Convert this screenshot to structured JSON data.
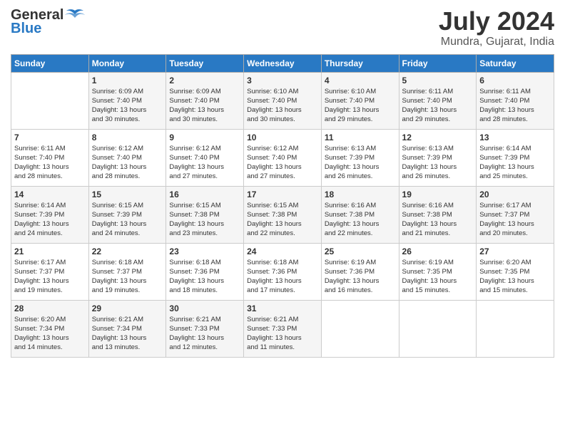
{
  "header": {
    "logo_line1": "General",
    "logo_line2": "Blue",
    "month": "July 2024",
    "location": "Mundra, Gujarat, India"
  },
  "days_of_week": [
    "Sunday",
    "Monday",
    "Tuesday",
    "Wednesday",
    "Thursday",
    "Friday",
    "Saturday"
  ],
  "weeks": [
    [
      {
        "day": "",
        "info": ""
      },
      {
        "day": "1",
        "info": "Sunrise: 6:09 AM\nSunset: 7:40 PM\nDaylight: 13 hours\nand 30 minutes."
      },
      {
        "day": "2",
        "info": "Sunrise: 6:09 AM\nSunset: 7:40 PM\nDaylight: 13 hours\nand 30 minutes."
      },
      {
        "day": "3",
        "info": "Sunrise: 6:10 AM\nSunset: 7:40 PM\nDaylight: 13 hours\nand 30 minutes."
      },
      {
        "day": "4",
        "info": "Sunrise: 6:10 AM\nSunset: 7:40 PM\nDaylight: 13 hours\nand 29 minutes."
      },
      {
        "day": "5",
        "info": "Sunrise: 6:11 AM\nSunset: 7:40 PM\nDaylight: 13 hours\nand 29 minutes."
      },
      {
        "day": "6",
        "info": "Sunrise: 6:11 AM\nSunset: 7:40 PM\nDaylight: 13 hours\nand 28 minutes."
      }
    ],
    [
      {
        "day": "7",
        "info": "Sunrise: 6:11 AM\nSunset: 7:40 PM\nDaylight: 13 hours\nand 28 minutes."
      },
      {
        "day": "8",
        "info": "Sunrise: 6:12 AM\nSunset: 7:40 PM\nDaylight: 13 hours\nand 28 minutes."
      },
      {
        "day": "9",
        "info": "Sunrise: 6:12 AM\nSunset: 7:40 PM\nDaylight: 13 hours\nand 27 minutes."
      },
      {
        "day": "10",
        "info": "Sunrise: 6:12 AM\nSunset: 7:40 PM\nDaylight: 13 hours\nand 27 minutes."
      },
      {
        "day": "11",
        "info": "Sunrise: 6:13 AM\nSunset: 7:39 PM\nDaylight: 13 hours\nand 26 minutes."
      },
      {
        "day": "12",
        "info": "Sunrise: 6:13 AM\nSunset: 7:39 PM\nDaylight: 13 hours\nand 26 minutes."
      },
      {
        "day": "13",
        "info": "Sunrise: 6:14 AM\nSunset: 7:39 PM\nDaylight: 13 hours\nand 25 minutes."
      }
    ],
    [
      {
        "day": "14",
        "info": "Sunrise: 6:14 AM\nSunset: 7:39 PM\nDaylight: 13 hours\nand 24 minutes."
      },
      {
        "day": "15",
        "info": "Sunrise: 6:15 AM\nSunset: 7:39 PM\nDaylight: 13 hours\nand 24 minutes."
      },
      {
        "day": "16",
        "info": "Sunrise: 6:15 AM\nSunset: 7:38 PM\nDaylight: 13 hours\nand 23 minutes."
      },
      {
        "day": "17",
        "info": "Sunrise: 6:15 AM\nSunset: 7:38 PM\nDaylight: 13 hours\nand 22 minutes."
      },
      {
        "day": "18",
        "info": "Sunrise: 6:16 AM\nSunset: 7:38 PM\nDaylight: 13 hours\nand 22 minutes."
      },
      {
        "day": "19",
        "info": "Sunrise: 6:16 AM\nSunset: 7:38 PM\nDaylight: 13 hours\nand 21 minutes."
      },
      {
        "day": "20",
        "info": "Sunrise: 6:17 AM\nSunset: 7:37 PM\nDaylight: 13 hours\nand 20 minutes."
      }
    ],
    [
      {
        "day": "21",
        "info": "Sunrise: 6:17 AM\nSunset: 7:37 PM\nDaylight: 13 hours\nand 19 minutes."
      },
      {
        "day": "22",
        "info": "Sunrise: 6:18 AM\nSunset: 7:37 PM\nDaylight: 13 hours\nand 19 minutes."
      },
      {
        "day": "23",
        "info": "Sunrise: 6:18 AM\nSunset: 7:36 PM\nDaylight: 13 hours\nand 18 minutes."
      },
      {
        "day": "24",
        "info": "Sunrise: 6:18 AM\nSunset: 7:36 PM\nDaylight: 13 hours\nand 17 minutes."
      },
      {
        "day": "25",
        "info": "Sunrise: 6:19 AM\nSunset: 7:36 PM\nDaylight: 13 hours\nand 16 minutes."
      },
      {
        "day": "26",
        "info": "Sunrise: 6:19 AM\nSunset: 7:35 PM\nDaylight: 13 hours\nand 15 minutes."
      },
      {
        "day": "27",
        "info": "Sunrise: 6:20 AM\nSunset: 7:35 PM\nDaylight: 13 hours\nand 15 minutes."
      }
    ],
    [
      {
        "day": "28",
        "info": "Sunrise: 6:20 AM\nSunset: 7:34 PM\nDaylight: 13 hours\nand 14 minutes."
      },
      {
        "day": "29",
        "info": "Sunrise: 6:21 AM\nSunset: 7:34 PM\nDaylight: 13 hours\nand 13 minutes."
      },
      {
        "day": "30",
        "info": "Sunrise: 6:21 AM\nSunset: 7:33 PM\nDaylight: 13 hours\nand 12 minutes."
      },
      {
        "day": "31",
        "info": "Sunrise: 6:21 AM\nSunset: 7:33 PM\nDaylight: 13 hours\nand 11 minutes."
      },
      {
        "day": "",
        "info": ""
      },
      {
        "day": "",
        "info": ""
      },
      {
        "day": "",
        "info": ""
      }
    ]
  ]
}
